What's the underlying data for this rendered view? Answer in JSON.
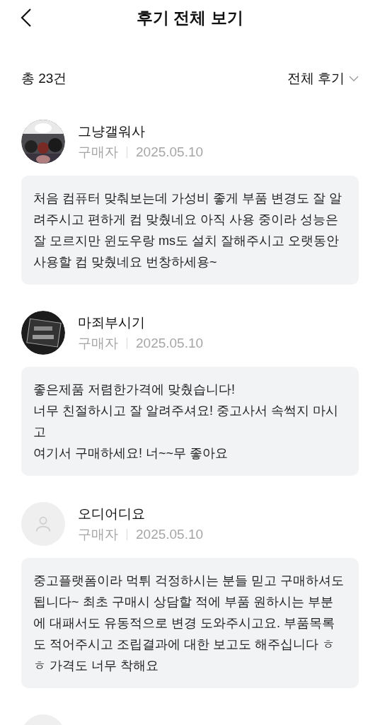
{
  "header": {
    "title": "후기 전체 보기"
  },
  "summary": {
    "count": "총 23건",
    "filter": "전체 후기"
  },
  "reviews": [
    {
      "avatar": {
        "kind": "picture"
      },
      "name": "그냥갤워사",
      "role": "구매자",
      "date": "2025.05.10",
      "lines": [
        "처음 컴퓨터 맞춰보는데 가성비 좋게 부품 변경도 잘 알",
        "려주시고 편하게 컴 맞췄네요 아직 사용 중이라 성능은",
        "잘 모르지만 윈도우랑 ms도 설치 잘해주시고 오랫동안",
        "사용할 컴 맞췄네요 번창하세용~"
      ]
    },
    {
      "avatar": {
        "kind": "picture"
      },
      "name": "마죄부시기",
      "role": "구매자",
      "date": "2025.05.10",
      "lines": [
        "좋은제품 저렴한가격에 맞췄습니다!",
        "너무 친절하시고 잘 알려주셔요! 중고사서 속썩지 마시",
        "고",
        "여기서 구매하세요! 너~~무 좋아요"
      ]
    },
    {
      "avatar": {
        "kind": "default"
      },
      "name": "오디어디요",
      "role": "구매자",
      "date": "2025.05.10",
      "lines": [
        "중고플랫폼이라 먹튀 걱정하시는 분들 믿고 구매하셔도",
        "됩니다~ 최초 구매시 상담할 적에 부품 원하시는 부분",
        "에 대패서도 유동적으로 변경 도와주시고요. 부품목록",
        "도 적어주시고 조립결과에 대한 보고도 해주십니다 ㅎ",
        "ㅎ 가격도 너무 착해요"
      ]
    }
  ]
}
